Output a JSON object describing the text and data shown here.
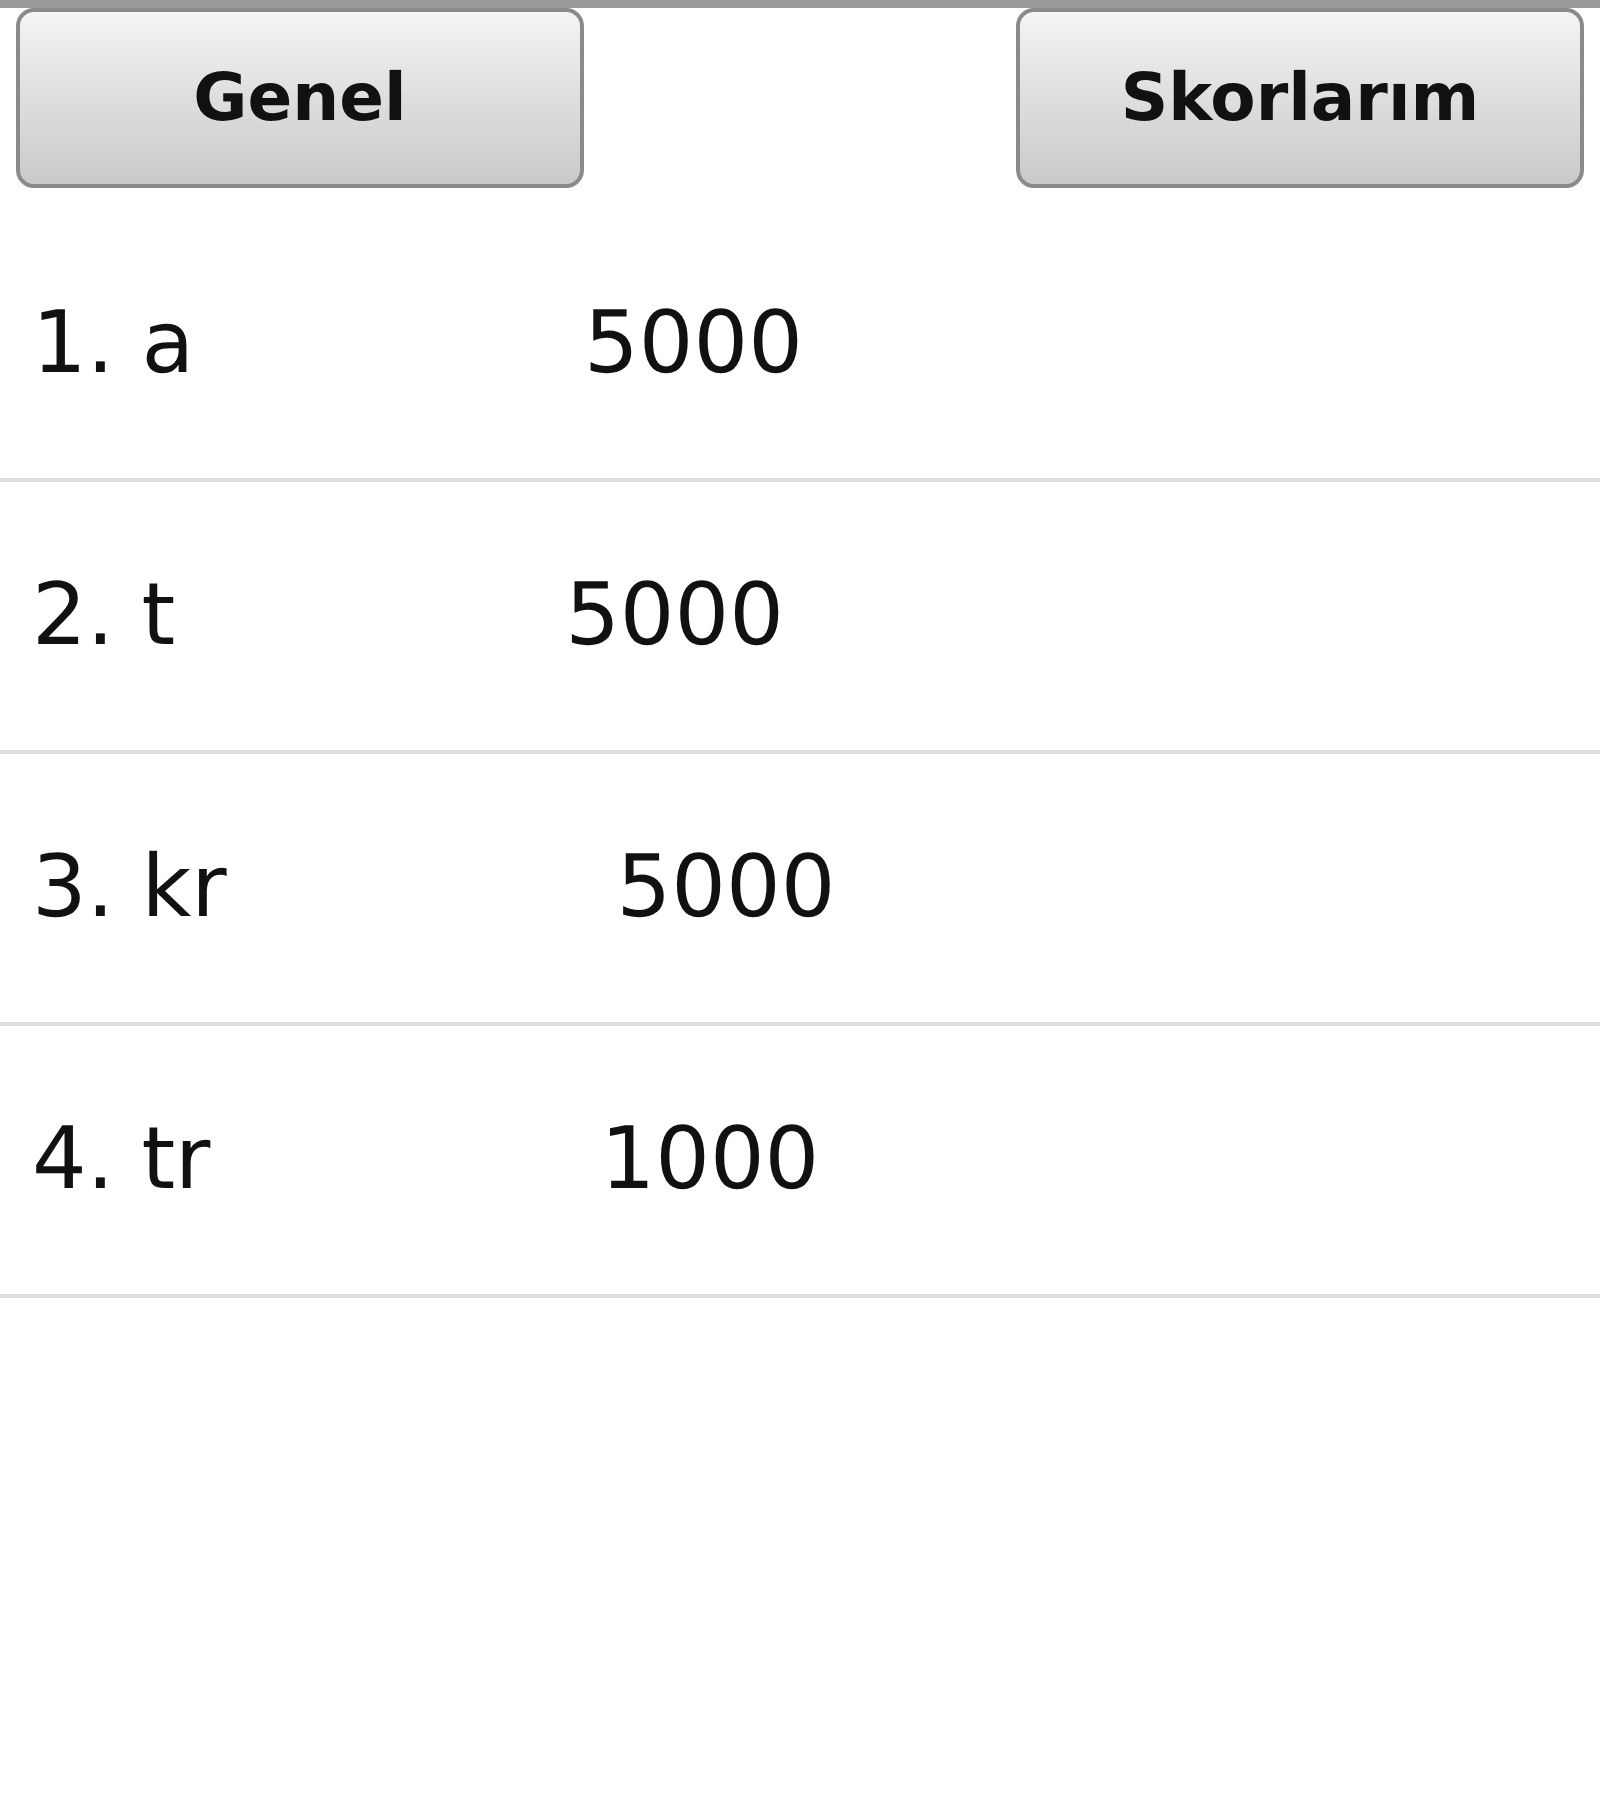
{
  "tabs": [
    {
      "label": "Genel"
    },
    {
      "label": "Skorlarım"
    }
  ],
  "scores": [
    {
      "rank_name": "1. a",
      "score": "5000"
    },
    {
      "rank_name": "2. t",
      "score": "5000"
    },
    {
      "rank_name": "3. kr",
      "score": "5000"
    },
    {
      "rank_name": "4. tr",
      "score": "1000"
    }
  ]
}
